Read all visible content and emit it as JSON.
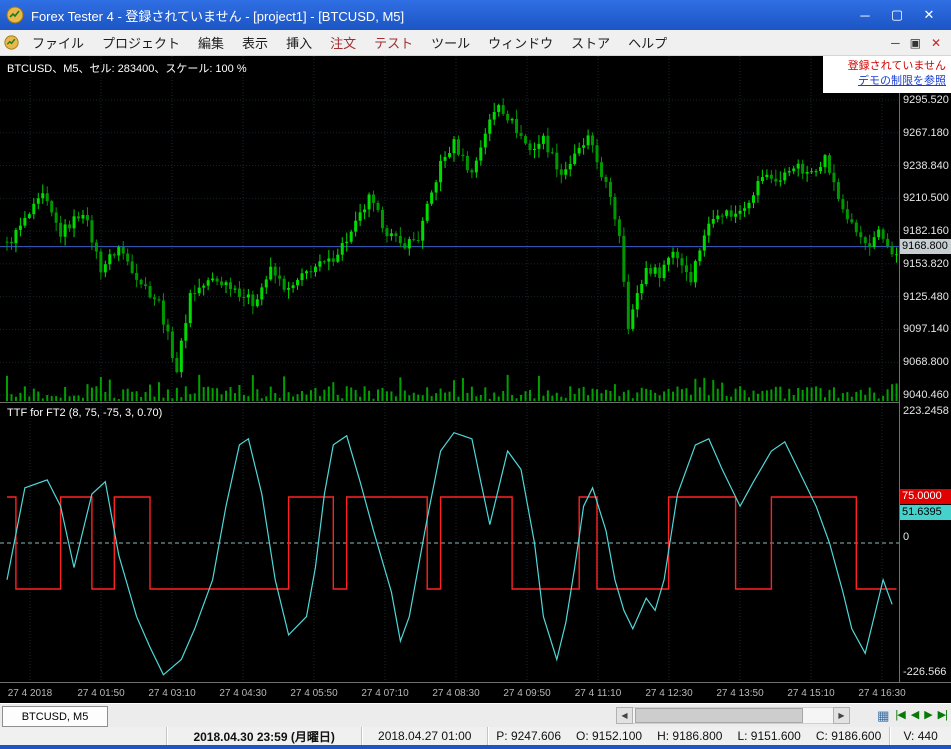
{
  "window": {
    "title": "Forex Tester 4 - 登録されていません - [project1] - [BTCUSD, M5]"
  },
  "icons": {
    "minimize": "─",
    "maximize": "▢",
    "close": "✕",
    "mdi_minimize": "─",
    "mdi_restore": "▣",
    "mdi_close": "✕",
    "scroll_left": "◀",
    "scroll_right": "▶",
    "nav_first": "|◀",
    "nav_prev": "◀",
    "nav_next": "▶",
    "nav_last": "▶|",
    "chart_grid": "▦"
  },
  "menu": {
    "items": [
      "ファイル",
      "プロジェクト",
      "編集",
      "表示",
      "挿入",
      "注文",
      "テスト",
      "ツール",
      "ウィンドウ",
      "ストア",
      "ヘルプ"
    ],
    "accent_indices": [
      5,
      6
    ],
    "accent_color": "#a03030"
  },
  "notice": {
    "unregistered": "登録されていません",
    "demo_link": "デモの制限を参照"
  },
  "chart": {
    "symbol_label": "BTCUSD、M5、セル: 283400、スケール: 100 %",
    "indicator_label": "TTF for FT2 (8, 75, -75, 3, 0.70)",
    "current_price": "9168.800",
    "price_axis": [
      "9295.520",
      "9267.180",
      "9238.840",
      "9210.500",
      "9182.160",
      "9153.820",
      "9125.480",
      "9097.140",
      "9068.800",
      "9040.460"
    ],
    "indicator_axis": {
      "top": "223.2458",
      "zero": "0",
      "bottom": "-226.566",
      "red_value": "75.0000",
      "cyan_value": "51.6395"
    },
    "time_axis": [
      "27 4 2018",
      "27 4 01:50",
      "27 4 03:10",
      "27 4 04:30",
      "27 4 05:50",
      "27 4 07:10",
      "27 4 08:30",
      "27 4 09:50",
      "27 4 11:10",
      "27 4 12:30",
      "27 4 13:50",
      "27 4 15:10",
      "27 4 16:30"
    ]
  },
  "chart_data": {
    "type": "candlestick",
    "symbol": "BTCUSD",
    "timeframe": "M5",
    "main": {
      "ylim": [
        9040.46,
        9295.52
      ],
      "grid_step": 28.34,
      "current_price": 9168.8,
      "close_path": [
        [
          0,
          9170
        ],
        [
          8,
          9212
        ],
        [
          12,
          9180
        ],
        [
          17,
          9200
        ],
        [
          21,
          9150
        ],
        [
          25,
          9168
        ],
        [
          30,
          9138
        ],
        [
          34,
          9120
        ],
        [
          38,
          9062
        ],
        [
          41,
          9128
        ],
        [
          46,
          9140
        ],
        [
          50,
          9136
        ],
        [
          55,
          9120
        ],
        [
          59,
          9148
        ],
        [
          63,
          9130
        ],
        [
          68,
          9150
        ],
        [
          72,
          9155
        ],
        [
          77,
          9180
        ],
        [
          81,
          9210
        ],
        [
          85,
          9182
        ],
        [
          88,
          9170
        ],
        [
          92,
          9176
        ],
        [
          97,
          9240
        ],
        [
          100,
          9258
        ],
        [
          104,
          9232
        ],
        [
          107,
          9268
        ],
        [
          110,
          9293
        ],
        [
          114,
          9270
        ],
        [
          117,
          9252
        ],
        [
          120,
          9262
        ],
        [
          124,
          9232
        ],
        [
          127,
          9246
        ],
        [
          130,
          9262
        ],
        [
          134,
          9222
        ],
        [
          137,
          9180
        ],
        [
          139,
          9102
        ],
        [
          143,
          9150
        ],
        [
          146,
          9146
        ],
        [
          149,
          9166
        ],
        [
          153,
          9142
        ],
        [
          156,
          9180
        ],
        [
          159,
          9200
        ],
        [
          163,
          9196
        ],
        [
          166,
          9210
        ],
        [
          169,
          9230
        ],
        [
          173,
          9226
        ],
        [
          176,
          9240
        ],
        [
          179,
          9230
        ],
        [
          183,
          9246
        ],
        [
          186,
          9210
        ],
        [
          189,
          9186
        ],
        [
          193,
          9166
        ],
        [
          195,
          9180
        ],
        [
          199,
          9160
        ]
      ]
    },
    "indicator": {
      "name": "TTF for FT2 (8, 75, -75, 3, 0.70)",
      "ylim": [
        -226.566,
        223.2458
      ],
      "zero": 0,
      "red_current": 75.0,
      "cyan_current": 51.6395,
      "red_levels": [
        75,
        -75
      ],
      "red_segments": [
        [
          0,
          2,
          75
        ],
        [
          2,
          12,
          -75
        ],
        [
          12,
          19,
          75
        ],
        [
          19,
          24,
          -75
        ],
        [
          24,
          32,
          75
        ],
        [
          32,
          63,
          -75
        ],
        [
          63,
          73,
          75
        ],
        [
          73,
          76,
          -75
        ],
        [
          76,
          94,
          75
        ],
        [
          94,
          97,
          -75
        ],
        [
          97,
          113,
          75
        ],
        [
          113,
          128,
          -75
        ],
        [
          128,
          132,
          75
        ],
        [
          132,
          148,
          -75
        ],
        [
          148,
          163,
          75
        ],
        [
          163,
          171,
          -75
        ],
        [
          171,
          190,
          75
        ],
        [
          190,
          199,
          -75
        ]
      ],
      "cyan_points": [
        [
          0,
          -60
        ],
        [
          4,
          90
        ],
        [
          9,
          103
        ],
        [
          12,
          60
        ],
        [
          15,
          -40
        ],
        [
          19,
          80
        ],
        [
          22,
          100
        ],
        [
          25,
          -20
        ],
        [
          29,
          -120
        ],
        [
          32,
          -170
        ],
        [
          35,
          -215
        ],
        [
          39,
          -190
        ],
        [
          42,
          -140
        ],
        [
          46,
          -60
        ],
        [
          49,
          60
        ],
        [
          52,
          160
        ],
        [
          54,
          170
        ],
        [
          57,
          80
        ],
        [
          60,
          -60
        ],
        [
          63,
          -150
        ],
        [
          67,
          -120
        ],
        [
          69,
          -40
        ],
        [
          71,
          80
        ],
        [
          73,
          160
        ],
        [
          76,
          175
        ],
        [
          79,
          100
        ],
        [
          82,
          20
        ],
        [
          86,
          -80
        ],
        [
          88,
          -160
        ],
        [
          90,
          -120
        ],
        [
          94,
          40
        ],
        [
          97,
          150
        ],
        [
          100,
          180
        ],
        [
          104,
          170
        ],
        [
          106,
          100
        ],
        [
          108,
          30
        ],
        [
          110,
          90
        ],
        [
          112,
          150
        ],
        [
          115,
          120
        ],
        [
          118,
          0
        ],
        [
          120,
          -120
        ],
        [
          123,
          -190
        ],
        [
          125,
          -130
        ],
        [
          127,
          -40
        ],
        [
          129,
          60
        ],
        [
          131,
          90
        ],
        [
          134,
          20
        ],
        [
          136,
          -60
        ],
        [
          138,
          -110
        ],
        [
          140,
          -140
        ],
        [
          143,
          -90
        ],
        [
          145,
          -110
        ],
        [
          147,
          -60
        ],
        [
          150,
          80
        ],
        [
          154,
          160
        ],
        [
          157,
          170
        ],
        [
          160,
          120
        ],
        [
          164,
          60
        ],
        [
          167,
          100
        ],
        [
          171,
          150
        ],
        [
          174,
          165
        ],
        [
          177,
          120
        ],
        [
          181,
          60
        ],
        [
          184,
          0
        ],
        [
          187,
          -80
        ],
        [
          189,
          -140
        ],
        [
          192,
          -180
        ],
        [
          194,
          -120
        ],
        [
          196,
          -60
        ],
        [
          198,
          -100
        ]
      ]
    },
    "x_count": 200
  },
  "tab": {
    "label": "BTCUSD, M5"
  },
  "statusbar": {
    "date": "2018.04.30 23:59 (月曜日)",
    "bar_time": "2018.04.27 01:00",
    "p": "P: 9247.606",
    "o": "O: 9152.100",
    "h": "H: 9186.800",
    "l": "L: 9151.600",
    "c": "C: 9186.600",
    "v": "V: 440"
  },
  "colors": {
    "titlebar": "#1c55c4",
    "candle_up": "#00dc00",
    "candle_down": "#009800",
    "volume": "#00a000",
    "cyan_line": "#4fd8d8",
    "red_line": "#ff2222",
    "current_price_line": "#3a5fc8",
    "unregistered_text": "#d00000",
    "link": "#1a3fd0"
  }
}
